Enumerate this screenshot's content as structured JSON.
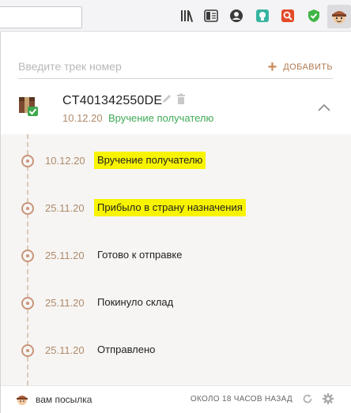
{
  "search": {
    "placeholder": "Введите трек номер",
    "value": ""
  },
  "add_button": {
    "label": "ДОБАВИТЬ"
  },
  "package": {
    "tracking_number": "CT401342550DE",
    "last_date": "10.12.20",
    "last_status": "Вручение получателю"
  },
  "timeline": [
    {
      "date": "10.12.20",
      "text": "Вручение получателю",
      "highlighted": true
    },
    {
      "date": "25.11.20",
      "text": "Прибыло в страну назначения",
      "highlighted": true
    },
    {
      "date": "25.11.20",
      "text": "Готово к отправке",
      "highlighted": false
    },
    {
      "date": "25.11.20",
      "text": "Покинуло склад",
      "highlighted": false
    },
    {
      "date": "25.11.20",
      "text": "Отправлено",
      "highlighted": false
    }
  ],
  "footer": {
    "user": "вам посылка",
    "updated": "ОКОЛО 18 ЧАСОВ НАЗАД"
  },
  "colors": {
    "accent": "#c98a5a",
    "status_green": "#3eaa55",
    "highlight": "#f8f400"
  },
  "icons": [
    "library-icon",
    "reader-view-icon",
    "account-icon",
    "extension-green-icon",
    "extension-red-icon",
    "shield-check-icon",
    "tracker-extension-icon",
    "package-icon",
    "edit-icon",
    "trash-icon",
    "chevron-up-icon",
    "refresh-icon",
    "settings-icon"
  ]
}
